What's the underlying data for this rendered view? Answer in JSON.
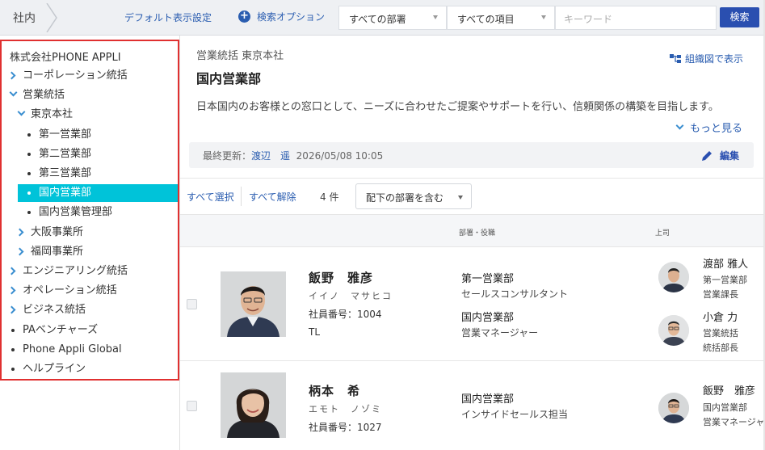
{
  "topbar": {
    "crumb": "社内",
    "default_view": "デフォルト表示設定",
    "search_options": "検索オプション",
    "dept_select": "すべての部署",
    "item_select": "すべての項目",
    "keyword_placeholder": "キーワード",
    "search_button": "検索"
  },
  "tree": {
    "root": "株式会社PHONE APPLI",
    "nodes": [
      {
        "label": "コーポレーション統括",
        "icon": "chevron-right-icon"
      },
      {
        "label": "営業統括",
        "icon": "chevron-down-icon"
      },
      {
        "label": "東京本社",
        "icon": "chevron-down-icon"
      },
      {
        "label": "第一営業部",
        "icon": "bullet"
      },
      {
        "label": "第二営業部",
        "icon": "bullet"
      },
      {
        "label": "第三営業部",
        "icon": "bullet"
      },
      {
        "label": "国内営業部",
        "icon": "bullet",
        "selected": true
      },
      {
        "label": "国内営業管理部",
        "icon": "bullet"
      },
      {
        "label": "大阪事業所",
        "icon": "chevron-right-icon"
      },
      {
        "label": "福岡事業所",
        "icon": "chevron-right-icon"
      },
      {
        "label": "エンジニアリング統括",
        "icon": "chevron-right-icon"
      },
      {
        "label": "オペレーション統括",
        "icon": "chevron-right-icon"
      },
      {
        "label": "ビジネス統括",
        "icon": "chevron-right-icon"
      },
      {
        "label": "PAベンチャーズ",
        "icon": "bullet"
      },
      {
        "label": "Phone Appli Global",
        "icon": "bullet"
      },
      {
        "label": "ヘルプライン",
        "icon": "bullet"
      }
    ],
    "highlight_color": "#00c3d9"
  },
  "dept": {
    "path": "営業統括 東京本社",
    "title": "国内営業部",
    "org_chart_link": "組織図で表示",
    "description": "日本国内のお客様との窓口として、ニーズに合わせたご提案やサポートを行い、信頼関係の構築を目指します。",
    "more": "もっと見る",
    "updated_label": "最終更新：",
    "updated_by": "渡辺　遥",
    "updated_at": "2026/05/08 10:05",
    "edit": "編集"
  },
  "toolbar": {
    "select_all": "すべて選択",
    "deselect_all": "すべて解除",
    "count": "4 件",
    "include_sub": "配下の部署を含む"
  },
  "table": {
    "col_dept_role": "部署・役職",
    "col_boss": "上司"
  },
  "people": [
    {
      "name": "飯野　雅彦",
      "kana": "イイノ　マサヒコ",
      "employee_no": "社員番号：1004",
      "tag": "TL",
      "positions": [
        {
          "dept": "第一営業部",
          "role": "セールスコンサルタント"
        },
        {
          "dept": "国内営業部",
          "role": "営業マネージャー"
        }
      ],
      "bosses": [
        {
          "name": "渡部 雅人",
          "dept": "第一営業部",
          "role": "営業課長"
        },
        {
          "name": "小倉 力",
          "dept": "営業統括",
          "role": "統括部長"
        }
      ]
    },
    {
      "name": "柄本　希",
      "kana": "エモト　ノゾミ",
      "employee_no": "社員番号：1027",
      "positions": [
        {
          "dept": "国内営業部",
          "role": "インサイドセールス担当"
        }
      ],
      "bosses": [
        {
          "name": "飯野　雅彦",
          "dept": "国内営業部",
          "role": "営業マネージャー"
        }
      ]
    }
  ]
}
